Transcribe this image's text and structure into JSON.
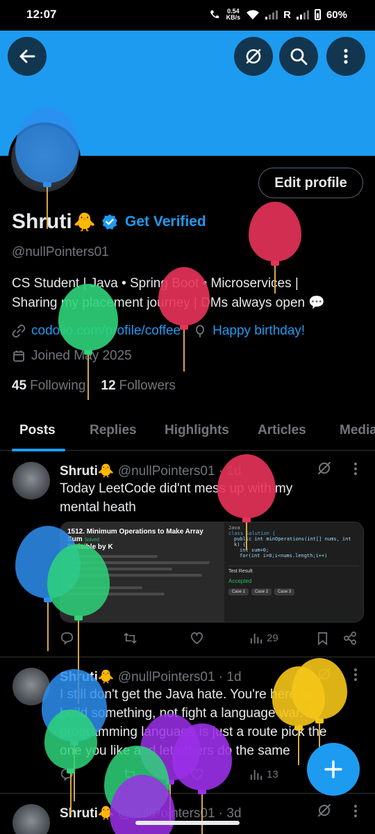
{
  "status_bar": {
    "time": "12:07",
    "net_speed_value": "0.54",
    "net_speed_unit": "KB/s",
    "carrier_r": "R",
    "battery": "60%"
  },
  "header": {
    "icons": [
      "back-arrow-icon",
      "grok-slash-icon",
      "search-icon",
      "more-vertical-icon"
    ]
  },
  "profile": {
    "edit_profile_label": "Edit profile",
    "name": "Shruti",
    "name_emoji": "🐥",
    "get_verified": "Get Verified",
    "handle": "@nullPointers01",
    "bio_line1": "CS Student | Java • Spring Boot • Microservices |",
    "bio_line2": "Sharing my placement journey | DMs always open 💬",
    "website": "codolio.com/profile/coffee",
    "birthday": "Happy birthday!",
    "joined": "Joined May 2025",
    "following_count": "45",
    "following_label": "Following",
    "followers_count": "12",
    "followers_label": "Followers"
  },
  "tabs": [
    "Posts",
    "Replies",
    "Highlights",
    "Articles",
    "Media"
  ],
  "posts": [
    {
      "author": "Shruti🐥",
      "handle_time": "@nullPointers01 · 1d",
      "text_line1": "Today LeetCode did'nt mess up with my",
      "text_line2": "mental heath",
      "views": "29",
      "media": {
        "problem_title": "1512. Minimum Operations to Make Array Sum",
        "problem_title2": "Divisible by K",
        "solved": "Solved",
        "code_lang": "Java",
        "code_line1": "class Solution {",
        "code_line2": "public int minOperations(int[] nums, int k) {",
        "code_line3": "int sum=0;",
        "code_line4": "for(int i=0;i<nums.length;i++)",
        "test_result": "Test Result",
        "accepted": "Accepted",
        "case1": "Case 1",
        "case2": "Case 2",
        "case3": "Case 3"
      }
    },
    {
      "author": "Shruti🐥",
      "handle_time": "@nullPointers01 · 1d",
      "text_line1": "I still don't get the Java hate. You're here to",
      "text_line2": "build something, not fight a language war. A",
      "text_line3": "programming language is just a route pick the",
      "text_line4": "one you like and let others do the same",
      "views": "13"
    },
    {
      "author": "Shruti🐥",
      "handle_time": "@nullPointers01 · 3d"
    }
  ],
  "colors": {
    "accent": "#1d9bf0",
    "background": "#000000",
    "muted": "#71767b",
    "balloon_red": "#e8335a",
    "balloon_green": "#2ed47a",
    "balloon_blue": "#2e8ef0",
    "balloon_yellow": "#f5c518",
    "balloon_purple": "#9b30e8"
  }
}
